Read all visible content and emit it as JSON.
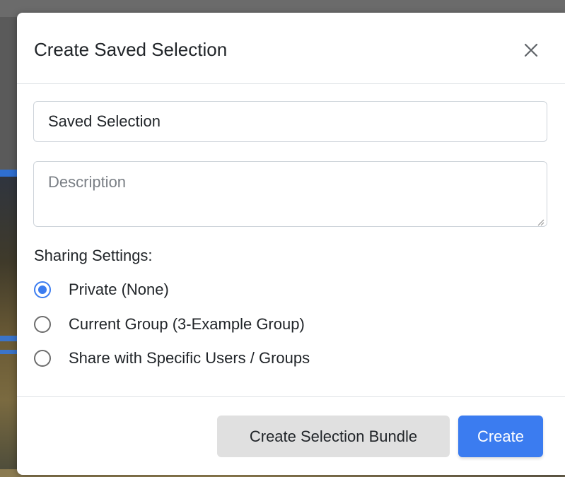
{
  "modal": {
    "title": "Create Saved Selection"
  },
  "form": {
    "name_value": "Saved Selection",
    "description_value": "",
    "description_placeholder": "Description",
    "sharing_label": "Sharing Settings:",
    "sharing_options": [
      {
        "label": "Private (None)",
        "checked": true
      },
      {
        "label": "Current Group (3-Example Group)",
        "checked": false
      },
      {
        "label": "Share with Specific Users / Groups",
        "checked": false
      }
    ]
  },
  "footer": {
    "secondary_label": "Create Selection Bundle",
    "primary_label": "Create"
  },
  "colors": {
    "primary": "#3b7cf0",
    "secondary_bg": "#e0e0e0",
    "text": "#212529",
    "border": "#dee2e6"
  },
  "icons": {
    "close": "close-icon",
    "resize": "resize-grip-icon"
  }
}
